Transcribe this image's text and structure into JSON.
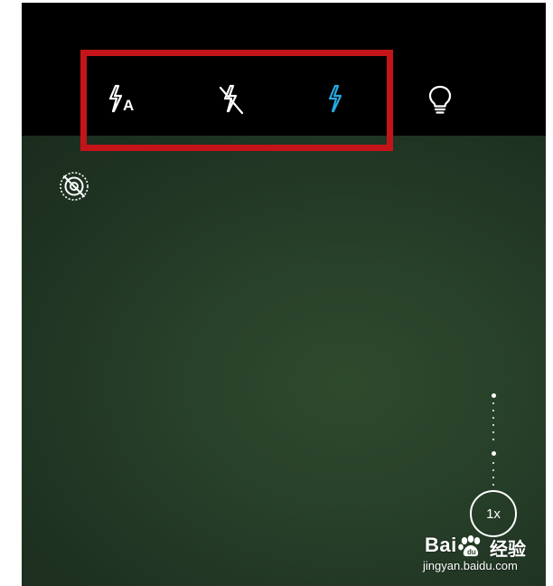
{
  "camera": {
    "flash_options": [
      {
        "name": "auto",
        "icon": "flash-auto-icon",
        "label": "A",
        "selected": false
      },
      {
        "name": "off",
        "icon": "flash-off-icon",
        "selected": false
      },
      {
        "name": "on",
        "icon": "flash-on-icon",
        "selected": true
      }
    ],
    "torch_icon": "lightbulb-icon",
    "hdr_icon": "hdr-off-icon",
    "zoom_label": "1x",
    "selected_color": "#29a8e0",
    "highlight_color": "#c4141a"
  },
  "watermark": {
    "brand_left": "Bai",
    "brand_right": "经验",
    "url": "jingyan.baidu.com"
  }
}
